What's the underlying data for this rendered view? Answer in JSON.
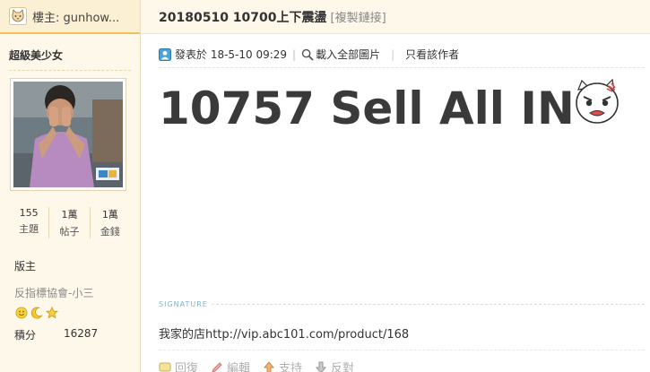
{
  "op": {
    "label": "樓主: gunhow...",
    "avatar_icon": "cat-icon"
  },
  "user": {
    "username": "超級美少女",
    "stats": [
      {
        "value": "155",
        "label": "主題"
      },
      {
        "value": "1萬",
        "label": "帖子"
      },
      {
        "value": "1萬",
        "label": "金錢"
      }
    ],
    "rank": "版主",
    "group": "反指標協會-小三",
    "medals": [
      "smiley-icon",
      "moon-icon",
      "star-icon"
    ],
    "credits_label": "積分",
    "credits_value": "16287"
  },
  "thread": {
    "title": "20180510 10700上下震盪",
    "copy_link": "[複製鏈接]"
  },
  "meta": {
    "posted": "發表於 18-5-10 09:29",
    "load_images": "載入全部圖片",
    "only_author": "只看該作者"
  },
  "post": {
    "text": "10757 Sell All IN",
    "emoji": "angry-face-icon"
  },
  "signature": {
    "label": "SIGNATURE",
    "text": "我家的店http://vip.abc101.com/product/168"
  },
  "actions": [
    {
      "label": "回復",
      "icon": "reply-icon"
    },
    {
      "label": "編輯",
      "icon": "pencil-icon"
    },
    {
      "label": "支持",
      "icon": "thumbs-up-icon"
    },
    {
      "label": "反對",
      "icon": "thumbs-down-icon"
    }
  ],
  "colors": {
    "sidebar_bg": "#fdf8ea",
    "accent_border": "#f2c25a",
    "signature_label": "#7fb4c7"
  }
}
